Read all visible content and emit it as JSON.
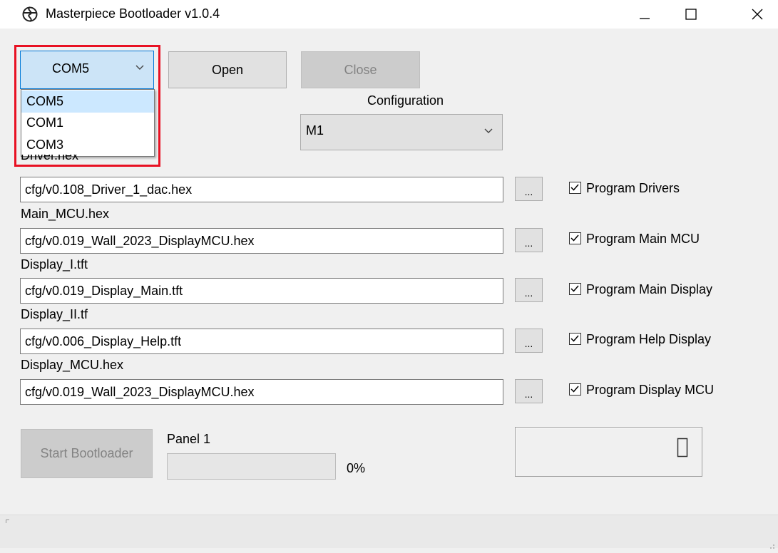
{
  "window": {
    "title": "Masterpiece Bootloader v1.0.4"
  },
  "toolbar": {
    "port_value": "COM5",
    "open_label": "Open",
    "close_label": "Close"
  },
  "port_dropdown": {
    "options": [
      "COM5",
      "COM1",
      "COM3"
    ],
    "selected": "COM5"
  },
  "configuration": {
    "label": "Configuration",
    "value": "M1"
  },
  "files": [
    {
      "label": "Driver.hex",
      "path": "cfg/v0.108_Driver_1_dac.hex",
      "browse": "...",
      "checkbox_label": "Program Drivers",
      "checked": true
    },
    {
      "label": "Main_MCU.hex",
      "path": "cfg/v0.019_Wall_2023_DisplayMCU.hex",
      "browse": "...",
      "checkbox_label": "Program Main MCU",
      "checked": true
    },
    {
      "label": "Display_I.tft",
      "path": "cfg/v0.019_Display_Main.tft",
      "browse": "...",
      "checkbox_label": "Program Main Display",
      "checked": true
    },
    {
      "label": "Display_II.tf",
      "path": "cfg/v0.006_Display_Help.tft",
      "browse": "...",
      "checkbox_label": "Program Help Display",
      "checked": true
    },
    {
      "label": "Display_MCU.hex",
      "path": "cfg/v0.019_Wall_2023_DisplayMCU.hex",
      "browse": "...",
      "checkbox_label": "Program Display MCU",
      "checked": true
    }
  ],
  "bootloader": {
    "start_label": "Start Bootloader",
    "panel_label": "Panel 1",
    "progress_fraction": 0,
    "progress_text": "0%",
    "counter_value": "0"
  },
  "colors": {
    "highlight": "#e81123",
    "combo_focus": "#cce4f7",
    "dropdown_selected": "#cce8ff"
  }
}
